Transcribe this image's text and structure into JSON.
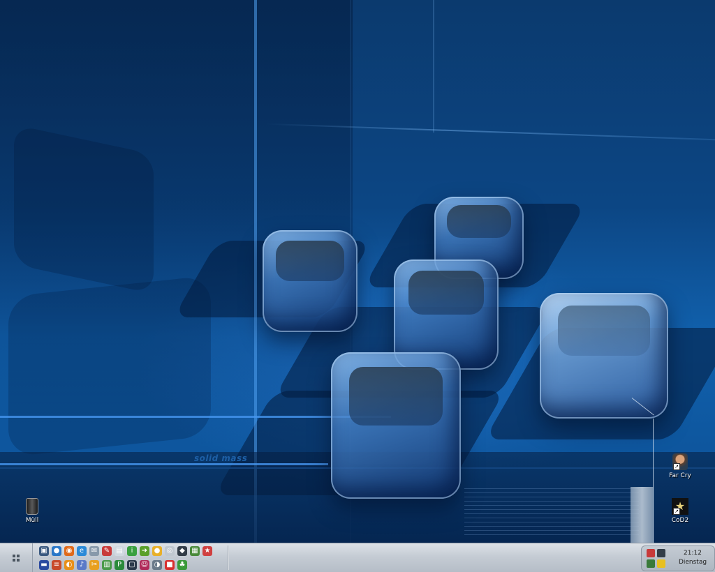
{
  "wallpaper": {
    "caption": "solid mass"
  },
  "desktop": {
    "icons": [
      {
        "label": "Müll",
        "icon": "trash-bin-icon"
      },
      {
        "label": "Far Cry",
        "icon": "far-cry-icon"
      },
      {
        "label": "CoD2",
        "icon": "cod2-icon"
      }
    ]
  },
  "taskbar": {
    "start_icon": "windows-grid-icon",
    "quick_launch": [
      {
        "icon": "my-computer-icon",
        "color": "#3b5a80",
        "glyph": "▣"
      },
      {
        "icon": "globe-icon",
        "color": "#2a78c8",
        "glyph": "●"
      },
      {
        "icon": "firefox-icon",
        "color": "#e06a1a",
        "glyph": "◉"
      },
      {
        "icon": "internet-explorer-icon",
        "color": "#2a8ad8",
        "glyph": "e"
      },
      {
        "icon": "mail-icon",
        "color": "#8899aa",
        "glyph": "✉"
      },
      {
        "icon": "paint-icon",
        "color": "#c83a3a",
        "glyph": "✎"
      },
      {
        "icon": "document-icon",
        "color": "#d0d8e0",
        "glyph": "▤"
      },
      {
        "icon": "info-icon",
        "color": "#3aa040",
        "glyph": "i"
      },
      {
        "icon": "arrow-icon",
        "color": "#5aa02a",
        "glyph": "➜"
      },
      {
        "icon": "media-icon",
        "color": "#e8b02a",
        "glyph": "●"
      },
      {
        "icon": "cd-icon",
        "color": "#c0c8d0",
        "glyph": "◎"
      },
      {
        "icon": "diamond-icon",
        "color": "#333d48",
        "glyph": "◆"
      },
      {
        "icon": "photo-icon",
        "color": "#4a8a3a",
        "glyph": "▦"
      },
      {
        "icon": "game-icon",
        "color": "#d04040",
        "glyph": "★"
      },
      {
        "icon": "save-icon",
        "color": "#2a4aa0",
        "glyph": "▬"
      },
      {
        "icon": "list-icon",
        "color": "#c84a2a",
        "glyph": "≡"
      },
      {
        "icon": "search-icon",
        "color": "#e8901a",
        "glyph": "◐"
      },
      {
        "icon": "music-icon",
        "color": "#5a7ac8",
        "glyph": "♪"
      },
      {
        "icon": "tool-icon",
        "color": "#e8a020",
        "glyph": "✂"
      },
      {
        "icon": "chart-icon",
        "color": "#4a9a4a",
        "glyph": "▥"
      },
      {
        "icon": "pro-icon",
        "color": "#2a8a3a",
        "glyph": "P"
      },
      {
        "icon": "window-icon",
        "color": "#2a3a4a",
        "glyph": "▢"
      },
      {
        "icon": "user-icon",
        "color": "#b02a5a",
        "glyph": "☺"
      },
      {
        "icon": "headset-icon",
        "color": "#6a7a8a",
        "glyph": "◑"
      },
      {
        "icon": "red-app-icon",
        "color": "#d83030",
        "glyph": "■"
      },
      {
        "icon": "leaf-icon",
        "color": "#3a9a3a",
        "glyph": "♣"
      }
    ],
    "tray": {
      "icons": [
        {
          "icon": "flag-icon",
          "color": "#c83a3a"
        },
        {
          "icon": "monitor-icon",
          "color": "#333d48"
        },
        {
          "icon": "network-icon",
          "color": "#3a7a3a"
        },
        {
          "icon": "security-icon",
          "color": "#e8c020"
        }
      ],
      "time": "21:12",
      "day": "Dienstag"
    }
  }
}
